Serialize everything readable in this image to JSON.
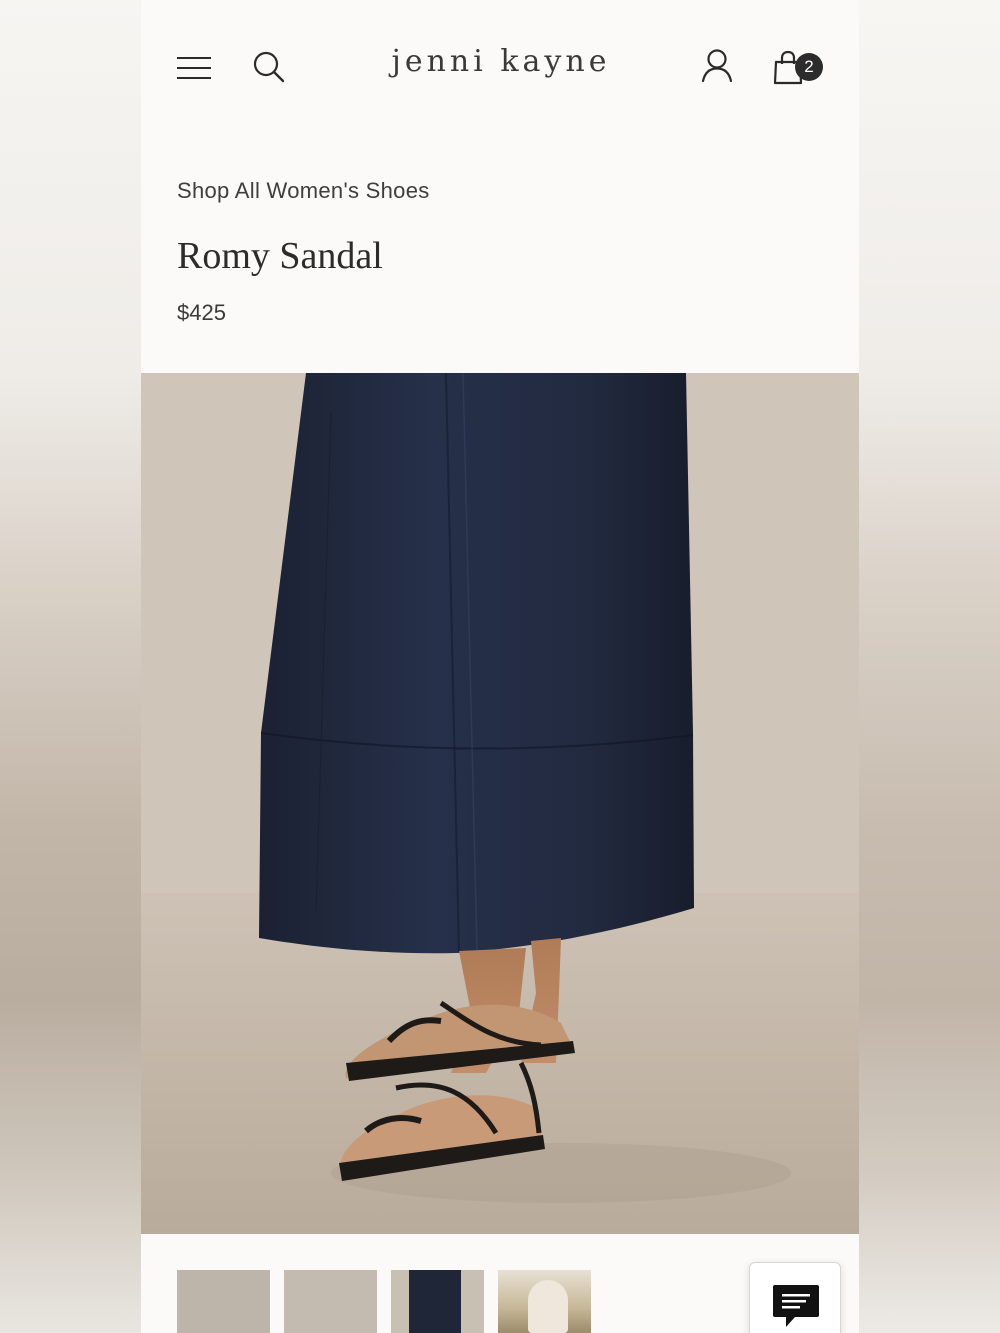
{
  "header": {
    "logo_text": "jenni kayne",
    "cart_count": "2"
  },
  "product": {
    "breadcrumb": "Shop All Women's Shoes",
    "title": "Romy Sandal",
    "price": "$425"
  },
  "gallery": {
    "thumbnail_count": 4
  },
  "icons": {
    "menu": "hamburger-menu-icon",
    "search": "search-icon",
    "account": "user-icon",
    "bag": "shopping-bag-icon",
    "chat": "chat-bubble-icon"
  },
  "colors": {
    "page_bg": "#fbfaf8",
    "text": "#2c2c2a",
    "badge": "#2c2c2c",
    "skirt": "#1f2638",
    "backdrop": "#c9bfb3"
  }
}
